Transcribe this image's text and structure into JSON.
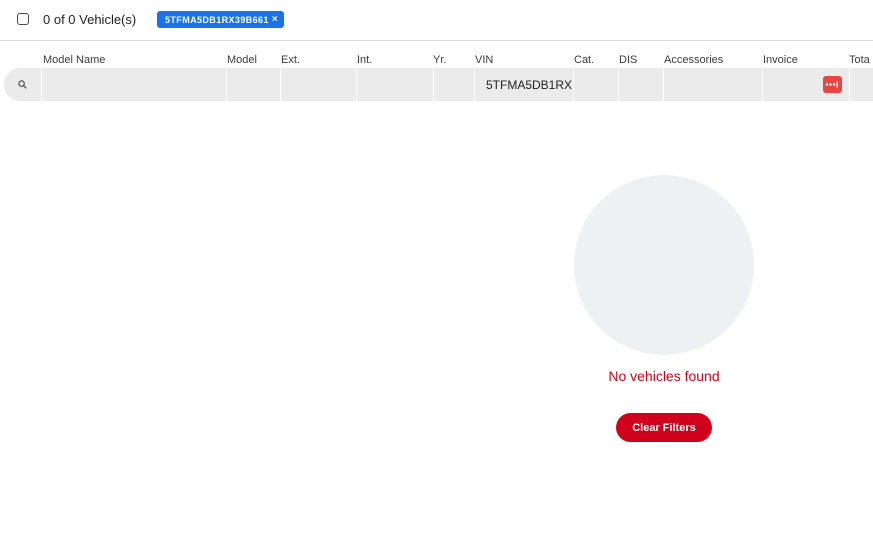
{
  "header": {
    "count_text": "0 of 0 Vehicle(s)",
    "filter_chip": {
      "label": "5TFMA5DB1RX39B661",
      "remove": "×"
    }
  },
  "columns": [
    "Model Name",
    "Model",
    "Ext.",
    "Int.",
    "Yr.",
    "VIN",
    "Cat.",
    "DIS",
    "Accessories",
    "Invoice",
    "Tota"
  ],
  "filters": {
    "search_icon": "search-icon",
    "vin_value": "5TFMA5DB1RX",
    "invoice_icon": "range-filter-icon",
    "invoice_icon_color": "#e84545"
  },
  "empty_state": {
    "message": "No vehicles found",
    "clear_label": "Clear Filters",
    "accent": "#d0021b"
  }
}
